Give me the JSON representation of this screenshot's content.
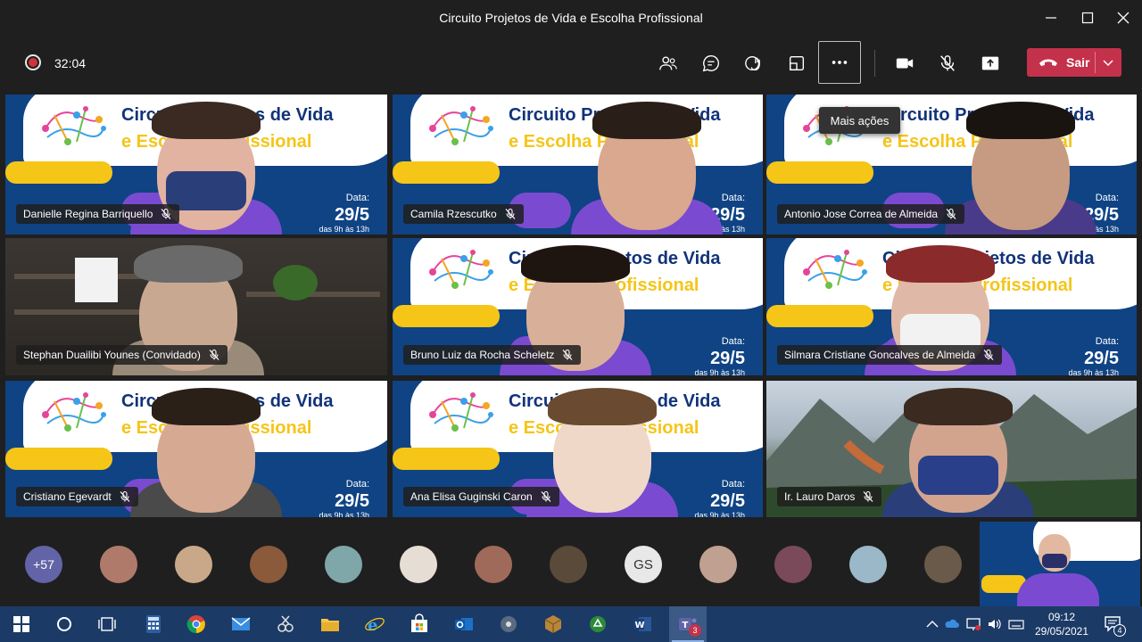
{
  "window": {
    "title": "Circuito Projetos de Vida e Escolha Profissional"
  },
  "meeting": {
    "timer": "32:04",
    "tooltip": "Mais ações",
    "leave_label": "Sair"
  },
  "banner": {
    "title": "Circuito Projetos de Vida",
    "subtitle": "e Escolha Profissional",
    "data_label": "Data:",
    "date": "29/5",
    "hours": "das 9h às 13h"
  },
  "participants": [
    {
      "name": "Danielle Regina Barriquello"
    },
    {
      "name": "Camila Rzescutko"
    },
    {
      "name": "Antonio Jose Correa de Almeida"
    },
    {
      "name": "Stephan Duailibi Younes (Convidado)"
    },
    {
      "name": "Bruno Luiz da Rocha Scheletz"
    },
    {
      "name": "Silmara Cristiane Goncalves de Almeida"
    },
    {
      "name": "Cristiano Egevardt"
    },
    {
      "name": "Ana Elisa Guginski Caron"
    },
    {
      "name": "Ir. Lauro Daros"
    }
  ],
  "strip": {
    "overflow_count": "+57",
    "initials_avatar": "GS"
  },
  "taskbar": {
    "time": "09:12",
    "date": "29/05/2021",
    "teams_badge": "3",
    "notifications_count": "4"
  },
  "colors": {
    "leave_red": "#c4314b",
    "teams_purple": "#6264a7",
    "taskbar_blue": "#1b3a66",
    "banner_blue": "#0f4384"
  }
}
